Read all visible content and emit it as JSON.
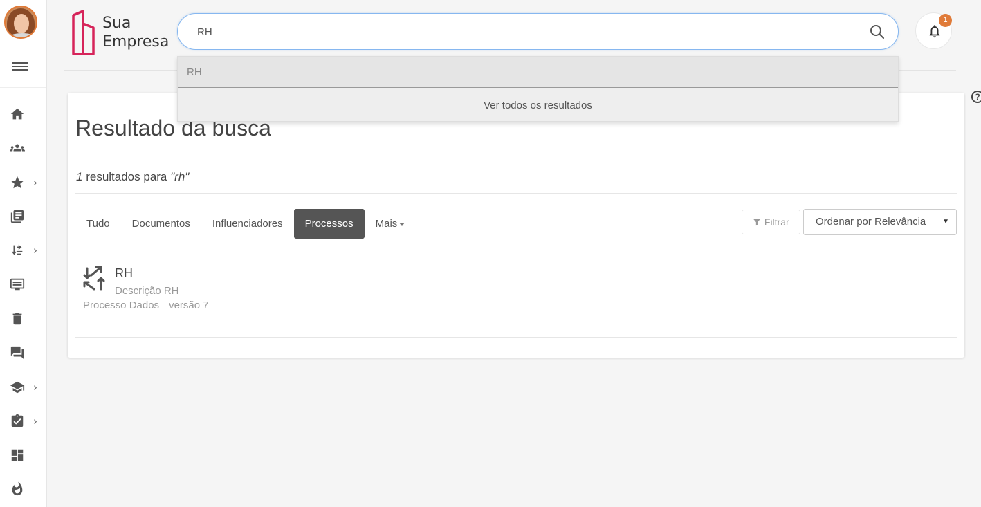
{
  "brand": {
    "name_line1": "Sua",
    "name_line2": "Empresa",
    "accent_color": "#d6245a"
  },
  "search": {
    "value": "RH",
    "placeholder": ""
  },
  "notifications": {
    "count": "1",
    "badge_color": "#e07b39"
  },
  "dropdown": {
    "suggestion": "RH",
    "see_all": "Ver todos os resultados"
  },
  "sidebar": {
    "items": [
      {
        "icon": "home-icon",
        "has_submenu": false
      },
      {
        "icon": "people-icon",
        "has_submenu": false
      },
      {
        "icon": "star-icon",
        "has_submenu": true
      },
      {
        "icon": "library-icon",
        "has_submenu": false
      },
      {
        "icon": "swap-icon",
        "has_submenu": true
      },
      {
        "icon": "monitor-icon",
        "has_submenu": false
      },
      {
        "icon": "trash-icon",
        "has_submenu": false
      },
      {
        "icon": "forum-icon",
        "has_submenu": false
      },
      {
        "icon": "school-icon",
        "has_submenu": true
      },
      {
        "icon": "clipboard-check-icon",
        "has_submenu": true
      },
      {
        "icon": "dashboard-icon",
        "has_submenu": false
      },
      {
        "icon": "flame-icon",
        "has_submenu": false
      }
    ],
    "chevron": "›"
  },
  "main": {
    "title": "Resultado da busca",
    "results_count": "1",
    "results_label": "resultados para",
    "results_query": "\"rh\"",
    "tabs": [
      {
        "label": "Tudo",
        "active": false
      },
      {
        "label": "Documentos",
        "active": false
      },
      {
        "label": "Influenciadores",
        "active": false
      },
      {
        "label": "Processos",
        "active": true
      },
      {
        "label": "Mais",
        "active": false
      }
    ],
    "filter_label": "Filtrar",
    "sort_label": "Ordenar por Relevância",
    "sort_arrow": "▼",
    "results": [
      {
        "title": "RH",
        "description": "Descrição RH",
        "type": "Processo Dados",
        "version": "versão 7",
        "icon": "process-swap-icon"
      }
    ]
  },
  "help_label": "?"
}
